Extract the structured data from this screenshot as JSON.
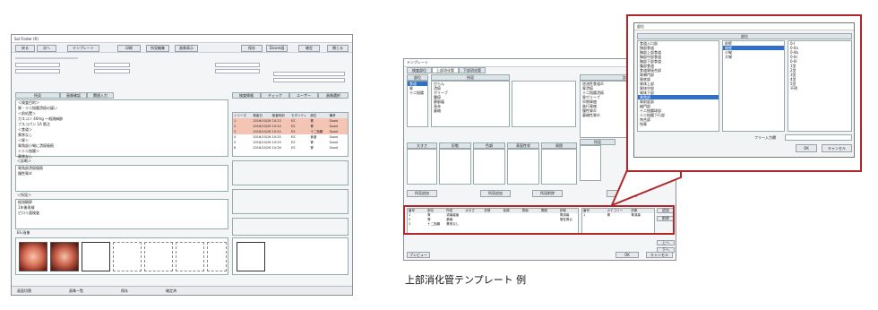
{
  "caption": "上部消化管テンプレート 例",
  "left_window": {
    "title": "Sol Finder (R)",
    "toolbar": [
      "戻る",
      "次へ",
      "テンプレート",
      "印刷",
      "所見編集",
      "画像表示",
      "保存",
      "Dicom画",
      "確定",
      "閉じる"
    ],
    "tabs": [
      "所見",
      "画像確認",
      "関連入力"
    ],
    "findings_text": [
      "＜検査目的＞",
      "胃・十二指腸潰瘍の疑い",
      "＜前処置＞",
      "ガスコン 40mg 〜咽頭麻酔",
      "ブスコパン 1A 筋注",
      "＜食道＞",
      "異常なし",
      "＜胃＞",
      "胃角部小彎に潰瘍瘢痕",
      "＜十二指腸＞",
      "異常なし"
    ],
    "section_labels": [
      "＜診断＞",
      "＜所見＞",
      "ES 画像"
    ],
    "diagnosis_text": [
      "胃角部潰瘍瘢痕",
      "慢性胃炎"
    ],
    "comment_text": [
      "経過観察",
      "1年後再検",
      "ピロリ菌検査"
    ],
    "right_tabs": [
      "検査情報",
      "チェック",
      "ユーザー",
      "画像選択"
    ],
    "table_headers": [
      "シリーズ",
      "検査日",
      "検査時刻",
      "モダリティ",
      "部位",
      "備考"
    ],
    "table_rows": [
      [
        "1",
        "2016/10/26",
        "10:23",
        "ES",
        "胃",
        "Good"
      ],
      [
        "2",
        "2016/10/26",
        "10:24",
        "ES",
        "胃",
        "Good"
      ],
      [
        "3",
        "2016/10/26",
        "10:24",
        "ES",
        "十二指腸",
        "Good"
      ],
      [
        "4",
        "2016/10/26",
        "10:25",
        "ES",
        "食道",
        "Good"
      ],
      [
        "5",
        "2016/10/26",
        "10:25",
        "ES",
        "胃",
        "Good"
      ],
      [
        "6",
        "2016/10/26",
        "10:26",
        "ES",
        "胃",
        "Good"
      ]
    ],
    "status": [
      "画面切替",
      "画像一覧",
      "保存",
      "確定済"
    ]
  },
  "middle_window": {
    "title": "テンプレート",
    "tabs": [
      "検査部位",
      "上部消化管",
      "下部消化管"
    ],
    "col_headers": [
      "部位",
      "所見",
      "診断"
    ],
    "part_list": [
      "食道",
      "胃",
      "十二指腸"
    ],
    "finding_list": [
      "びらん",
      "潰瘍",
      "ポリープ",
      "腫瘍",
      "静脈瘤",
      "発赤",
      "萎縮"
    ],
    "diag_list": [
      "逆流性食道炎",
      "胃潰瘍",
      "十二指腸潰瘍",
      "胃ポリープ",
      "早期胃癌",
      "進行胃癌",
      "慢性胃炎",
      "萎縮性胃炎"
    ],
    "lower_headers": [
      "大きさ",
      "形態",
      "色調",
      "表面性状",
      "周囲",
      "所見"
    ],
    "buttons": [
      "所見追加",
      "所見追加",
      "所見削除",
      "追加"
    ],
    "grid_headers": [
      "番号",
      "部位",
      "所見",
      "大きさ",
      "形態",
      "色調",
      "表面",
      "周囲",
      "診断"
    ],
    "grid_rows": [
      [
        "1",
        "胃",
        "潰瘍瘢痕",
        "",
        "",
        "",
        "",
        "",
        "胃潰瘍"
      ],
      [
        "2",
        "胃",
        "萎縮",
        "",
        "",
        "",
        "",
        "",
        "慢性胃炎"
      ],
      [
        "3",
        "十二指腸",
        "異常なし",
        "",
        "",
        "",
        "",
        "",
        ""
      ]
    ],
    "right_grid_headers": [
      "番号",
      "カテゴリー",
      "診断"
    ],
    "right_grid_rows": [
      [
        "1",
        "胃",
        "胃潰瘍"
      ]
    ],
    "side_buttons": [
      "追加",
      "削除",
      "上へ",
      "下へ"
    ],
    "footer_buttons": [
      "プレビュー",
      "OK",
      "キャンセル"
    ]
  },
  "dialog": {
    "title": "部位",
    "header": "部位",
    "list1": [
      "食道入口部",
      "頸部食道",
      "胸部上部食道",
      "胸部中部食道",
      "胸部下部食道",
      "腹部食道",
      "食道胃接合部",
      "胃噴門部",
      "胃底部",
      "胃体上部",
      "胃体中部",
      "胃体下部",
      "胃角部",
      "胃前庭部",
      "幽門部",
      "十二指腸球部",
      "十二指腸下行部",
      "吻合部",
      "残胃"
    ],
    "list2": [
      "前壁",
      "後壁",
      "小彎",
      "大彎"
    ],
    "list3": [
      "0-I",
      "0-IIa",
      "0-IIb",
      "0-IIc",
      "0-III",
      "1型",
      "2型",
      "3型",
      "4型",
      "5型",
      "不明"
    ],
    "input_label": "フリー入力欄",
    "ok": "OK",
    "cancel": "キャンセル"
  },
  "colors": {
    "accent": "#b0262a",
    "select": "#2f6fc7",
    "row_hi": "#f4c5b5"
  }
}
